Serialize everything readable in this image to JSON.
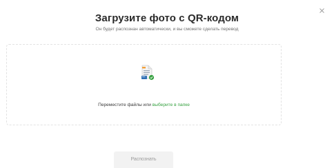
{
  "dialog": {
    "title": "Загрузите фото с QR-кодом",
    "subtitle": "Он будет распознан автоматически, и вы сможете сделать перевод"
  },
  "dropzone": {
    "icon": "document-upload-icon",
    "text_prefix": "Переместите файлы или",
    "link_label": "выберите в папке"
  },
  "actions": {
    "recognize_label": "Распознать",
    "close_icon": "close-icon"
  },
  "colors": {
    "accent": "#37a141",
    "title": "#2b2b2b",
    "muted": "#6f6f6f",
    "button_bg": "#f2f2f2",
    "button_text": "#9a9a9a"
  }
}
